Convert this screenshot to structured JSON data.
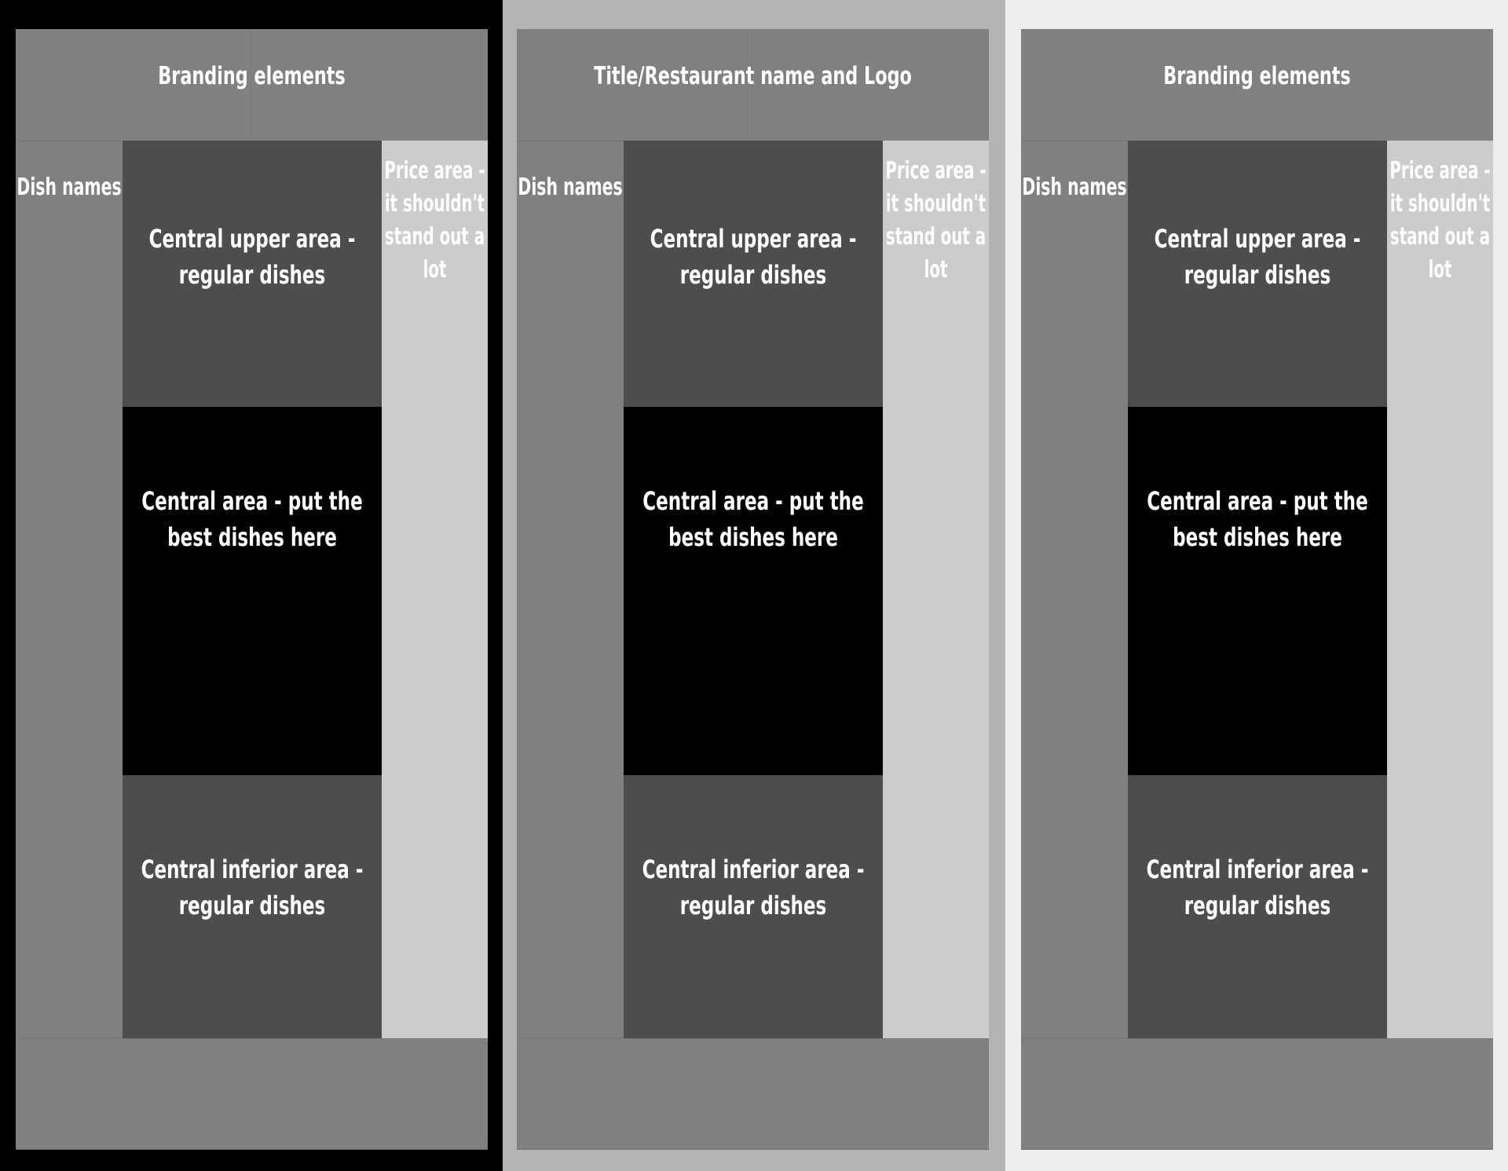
{
  "panels": [
    {
      "theme": "dark",
      "background": "#000000",
      "header": "Branding elements",
      "dish_column": "Dish names",
      "center_upper": "Central upper area -\nregular dishes",
      "center_main": "Central area - put the\nbest dishes here",
      "center_lower": "Central inferior area -\nregular dishes",
      "price_column": "Price area -\nit shouldn't\nstand out a\nlot",
      "footer": ""
    },
    {
      "theme": "medium",
      "background": "#b3b3b3",
      "header": "Title/Restaurant name and Logo",
      "dish_column": "Dish names",
      "center_upper": "Central upper area -\nregular dishes",
      "center_main": "Central area - put the\nbest dishes here",
      "center_lower": "Central inferior area -\nregular dishes",
      "price_column": "Price area -\nit shouldn't\nstand out a\nlot",
      "footer": ""
    },
    {
      "theme": "light",
      "background": "#eeeeee",
      "header": "Branding elements",
      "dish_column": "Dish names",
      "center_upper": "Central upper area -\nregular dishes",
      "center_main": "Central area - put the\nbest dishes here",
      "center_lower": "Central inferior area -\nregular dishes",
      "price_column": "Price area -\nit shouldn't\nstand out a\nlot",
      "footer": ""
    }
  ],
  "colors": {
    "header_footer": "#808080",
    "dish_column": "#808080",
    "center_regular": "#4d4d4d",
    "center_best": "#000000",
    "price_column": "#cccccc",
    "text": "#ffffff"
  }
}
